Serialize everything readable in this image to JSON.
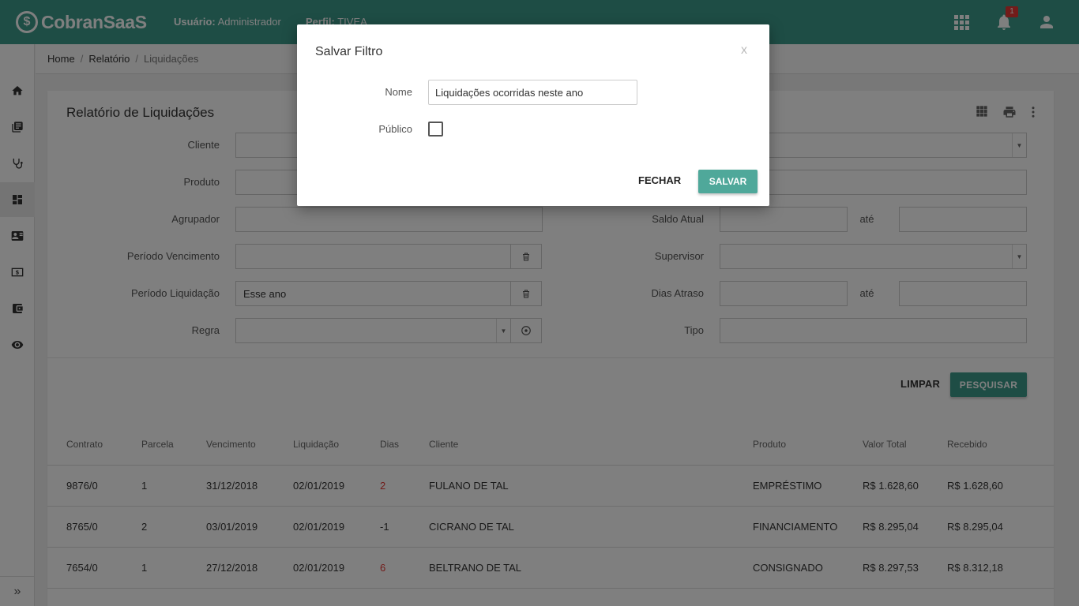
{
  "app": {
    "logo_text": "CobranSaaS",
    "user_label": "Usuário:",
    "user_value": "Administrador",
    "profile_label": "Perfil:",
    "profile_value": "TIVEA",
    "notification_count": "1"
  },
  "sidebar": {
    "items": [
      "home-icon",
      "library-icon",
      "stethoscope-icon",
      "dashboard-icon",
      "contact-card-icon",
      "money-icon",
      "wallet-icon",
      "eye-icon"
    ],
    "active_index": 3,
    "expand_glyph": "»"
  },
  "breadcrumb": {
    "items": [
      "Home",
      "Relatório",
      "Liquidações"
    ],
    "separator": "/"
  },
  "page": {
    "title": "Relatório de Liquidações"
  },
  "filters": {
    "left": [
      {
        "label": "Cliente",
        "value": ""
      },
      {
        "label": "Produto",
        "value": ""
      },
      {
        "label": "Agrupador",
        "value": ""
      },
      {
        "label": "Período Vencimento",
        "value": ""
      },
      {
        "label": "Período Liquidação",
        "value": "Esse ano"
      },
      {
        "label": "Regra",
        "value": ""
      }
    ],
    "right": [
      {
        "label": "Saldo Atual",
        "value": "",
        "range_label": "até"
      },
      {
        "label": "Supervisor",
        "value": ""
      },
      {
        "label": "Dias Atraso",
        "value": "",
        "range_label": "até"
      },
      {
        "label": "Tipo",
        "value": ""
      }
    ],
    "clear_label": "LIMPAR",
    "search_label": "PESQUISAR"
  },
  "table": {
    "columns": [
      "Contrato",
      "Parcela",
      "Vencimento",
      "Liquidação",
      "Dias",
      "Cliente",
      "Produto",
      "Valor Total",
      "Recebido"
    ],
    "rows": [
      {
        "contrato": "9876/0",
        "parcela": "1",
        "vencimento": "31/12/2018",
        "liquidacao": "02/01/2019",
        "dias": "2",
        "cliente": "FULANO DE TAL",
        "produto": "EMPRÉSTIMO",
        "valor_total": "R$ 1.628,60",
        "recebido": "R$ 1.628,60"
      },
      {
        "contrato": "8765/0",
        "parcela": "2",
        "vencimento": "03/01/2019",
        "liquidacao": "02/01/2019",
        "dias": "-1",
        "cliente": "CICRANO DE TAL",
        "produto": "FINANCIAMENTO",
        "valor_total": "R$ 8.295,04",
        "recebido": "R$ 8.295,04"
      },
      {
        "contrato": "7654/0",
        "parcela": "1",
        "vencimento": "27/12/2018",
        "liquidacao": "02/01/2019",
        "dias": "6",
        "cliente": "BELTRANO DE TAL",
        "produto": "CONSIGNADO",
        "valor_total": "R$ 8.297,53",
        "recebido": "R$ 8.312,18"
      }
    ]
  },
  "modal": {
    "title": "Salvar Filtro",
    "close_glyph": "x",
    "name_label": "Nome",
    "name_value": "Liquidações ocorridas neste ano",
    "public_label": "Público",
    "close_label": "FECHAR",
    "save_label": "SALVAR"
  },
  "colors": {
    "brand": "#3d9a8b",
    "danger": "#e53935"
  }
}
